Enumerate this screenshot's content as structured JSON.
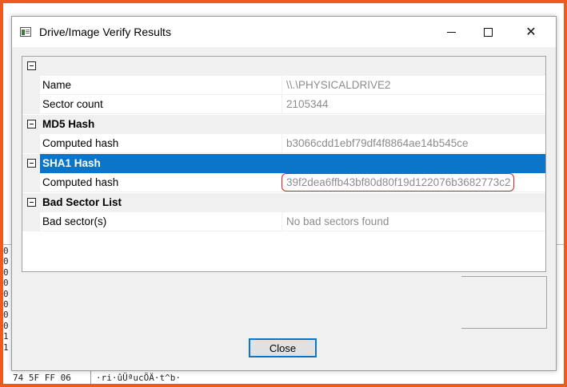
{
  "background_app": {
    "left_column_chars": [
      "0",
      "0",
      "0",
      "0",
      "0",
      "0",
      "0",
      "0",
      "1",
      "1"
    ],
    "bottom_row_hex": "74 5F FF 06",
    "bottom_row_text": "·ri·ûÜªucÕÄ·t^b·"
  },
  "dialog": {
    "title": "Drive/Image Verify Results",
    "controls": {
      "minimize": "minimize",
      "maximize": "maximize",
      "close": "✕"
    },
    "grid": {
      "top_category": {
        "label": ""
      },
      "name": {
        "label": "Name",
        "value": "\\\\.\\PHYSICALDRIVE2"
      },
      "sector_count": {
        "label": "Sector count",
        "value": "2105344"
      },
      "md5": {
        "category": "MD5 Hash",
        "label": "Computed hash",
        "value": "b3066cdd1ebf79df4f8864ae14b545ce"
      },
      "sha1": {
        "category": "SHA1 Hash",
        "label": "Computed hash",
        "value": "39f2dea6ffb43bf80d80f19d122076b3682773c2"
      },
      "bad_sectors": {
        "category": "Bad Sector List",
        "label": "Bad sector(s)",
        "value": "No bad sectors found"
      }
    },
    "close_button": "Close"
  },
  "colors": {
    "frame_border": "#f05a1c",
    "selection": "#0a75c9",
    "highlight": "#d9261c"
  }
}
